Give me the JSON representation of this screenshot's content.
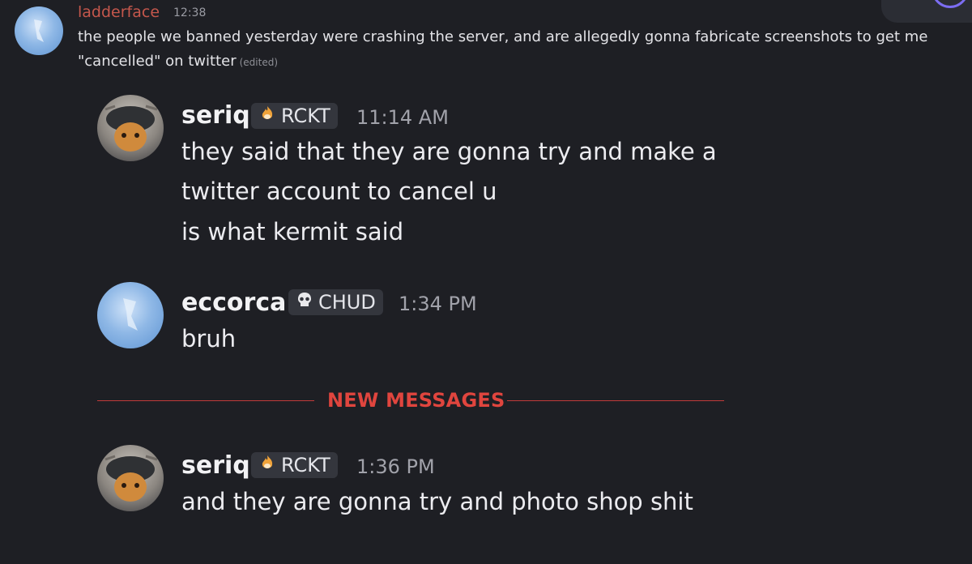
{
  "first_message": {
    "username": "ladderface",
    "time": "12:38",
    "line1": "the people we banned yesterday were crashing the server, and are allegedly gonna fabricate screenshots to get me",
    "line2": "\"cancelled\" on twitter",
    "edited": "(edited)"
  },
  "messages": [
    {
      "username": "seriq",
      "tag_icon": "flame-icon",
      "tag": "RCKT",
      "time": "11:14 AM",
      "lines": [
        "they said that they are gonna try and make a",
        "twitter account to cancel u",
        "is what kermit said"
      ]
    },
    {
      "username": "eccorca",
      "tag_icon": "skull-icon",
      "tag": "CHUD",
      "time": "1:34 PM",
      "lines": [
        "bruh"
      ]
    },
    {
      "username": "seriq",
      "tag_icon": "flame-icon",
      "tag": "RCKT",
      "time": "1:36 PM",
      "lines": [
        "and they are gonna try and photo shop shit"
      ]
    }
  ],
  "divider": {
    "label": "NEW MESSAGES"
  },
  "colors": {
    "background": "#1e1f24",
    "first_username": "#c4574c",
    "new_messages": "#e0453e",
    "tag_background": "#34363d"
  }
}
